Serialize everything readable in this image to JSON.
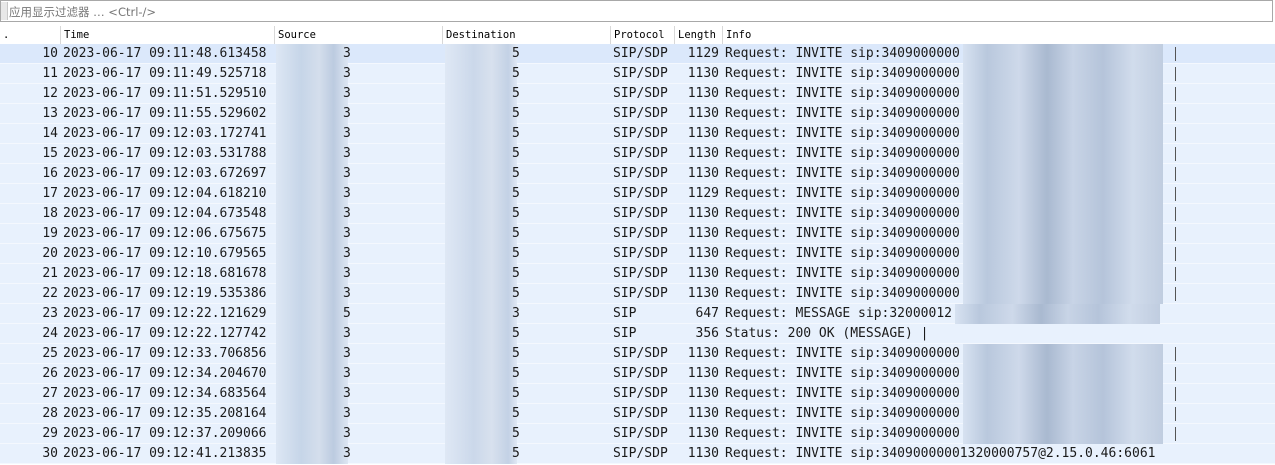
{
  "filter": {
    "placeholder": "应用显示过滤器 … <Ctrl-/>"
  },
  "columns": [
    {
      "label": "."
    },
    {
      "label": "Time"
    },
    {
      "label": "Source"
    },
    {
      "label": "Destination"
    },
    {
      "label": "Protocol"
    },
    {
      "label": "Length"
    },
    {
      "label": "Info"
    }
  ],
  "packets": [
    {
      "no": "10",
      "time": "2023-06-17 09:11:48.613458",
      "src": "3",
      "dst": "5",
      "proto": "SIP/SDP",
      "len": "1129",
      "info": "Request: INVITE sip:3409000000",
      "bar": true
    },
    {
      "no": "11",
      "time": "2023-06-17 09:11:49.525718",
      "src": "3",
      "dst": "5",
      "proto": "SIP/SDP",
      "len": "1130",
      "info": "Request: INVITE sip:3409000000",
      "bar": true
    },
    {
      "no": "12",
      "time": "2023-06-17 09:11:51.529510",
      "src": "3",
      "dst": "5",
      "proto": "SIP/SDP",
      "len": "1130",
      "info": "Request: INVITE sip:3409000000",
      "bar": true
    },
    {
      "no": "13",
      "time": "2023-06-17 09:11:55.529602",
      "src": "3",
      "dst": "5",
      "proto": "SIP/SDP",
      "len": "1130",
      "info": "Request: INVITE sip:3409000000",
      "bar": true
    },
    {
      "no": "14",
      "time": "2023-06-17 09:12:03.172741",
      "src": "3",
      "dst": "5",
      "proto": "SIP/SDP",
      "len": "1130",
      "info": "Request: INVITE sip:3409000000",
      "bar": true
    },
    {
      "no": "15",
      "time": "2023-06-17 09:12:03.531788",
      "src": "3",
      "dst": "5",
      "proto": "SIP/SDP",
      "len": "1130",
      "info": "Request: INVITE sip:3409000000",
      "bar": true
    },
    {
      "no": "16",
      "time": "2023-06-17 09:12:03.672697",
      "src": "3",
      "dst": "5",
      "proto": "SIP/SDP",
      "len": "1130",
      "info": "Request: INVITE sip:3409000000",
      "bar": true
    },
    {
      "no": "17",
      "time": "2023-06-17 09:12:04.618210",
      "src": "3",
      "dst": "5",
      "proto": "SIP/SDP",
      "len": "1129",
      "info": "Request: INVITE sip:3409000000",
      "bar": true
    },
    {
      "no": "18",
      "time": "2023-06-17 09:12:04.673548",
      "src": "3",
      "dst": "5",
      "proto": "SIP/SDP",
      "len": "1130",
      "info": "Request: INVITE sip:3409000000",
      "bar": true
    },
    {
      "no": "19",
      "time": "2023-06-17 09:12:06.675675",
      "src": "3",
      "dst": "5",
      "proto": "SIP/SDP",
      "len": "1130",
      "info": "Request: INVITE sip:3409000000",
      "bar": true
    },
    {
      "no": "20",
      "time": "2023-06-17 09:12:10.679565",
      "src": "3",
      "dst": "5",
      "proto": "SIP/SDP",
      "len": "1130",
      "info": "Request: INVITE sip:3409000000",
      "bar": true
    },
    {
      "no": "21",
      "time": "2023-06-17 09:12:18.681678",
      "src": "3",
      "dst": "5",
      "proto": "SIP/SDP",
      "len": "1130",
      "info": "Request: INVITE sip:3409000000",
      "bar": true
    },
    {
      "no": "22",
      "time": "2023-06-17 09:12:19.535386",
      "src": "3",
      "dst": "5",
      "proto": "SIP/SDP",
      "len": "1130",
      "info": "Request: INVITE sip:3409000000",
      "bar": true
    },
    {
      "no": "23",
      "time": "2023-06-17 09:12:22.121629",
      "src": "5",
      "dst": "3",
      "proto": "SIP",
      "len": "647",
      "info": "Request: MESSAGE sip:32000012",
      "bar": false
    },
    {
      "no": "24",
      "time": "2023-06-17 09:12:22.127742",
      "src": "3",
      "dst": "5",
      "proto": "SIP",
      "len": "356",
      "info": "Status: 200 OK (MESSAGE) |",
      "bar": false
    },
    {
      "no": "25",
      "time": "2023-06-17 09:12:33.706856",
      "src": "3",
      "dst": "5",
      "proto": "SIP/SDP",
      "len": "1130",
      "info": "Request: INVITE sip:3409000000",
      "bar": true
    },
    {
      "no": "26",
      "time": "2023-06-17 09:12:34.204670",
      "src": "3",
      "dst": "5",
      "proto": "SIP/SDP",
      "len": "1130",
      "info": "Request: INVITE sip:3409000000",
      "bar": true
    },
    {
      "no": "27",
      "time": "2023-06-17 09:12:34.683564",
      "src": "3",
      "dst": "5",
      "proto": "SIP/SDP",
      "len": "1130",
      "info": "Request: INVITE sip:3409000000",
      "bar": true
    },
    {
      "no": "28",
      "time": "2023-06-17 09:12:35.208164",
      "src": "3",
      "dst": "5",
      "proto": "SIP/SDP",
      "len": "1130",
      "info": "Request: INVITE sip:3409000000",
      "bar": true
    },
    {
      "no": "29",
      "time": "2023-06-17 09:12:37.209066",
      "src": "3",
      "dst": "5",
      "proto": "SIP/SDP",
      "len": "1130",
      "info": "Request: INVITE sip:3409000000",
      "bar": true
    },
    {
      "no": "30",
      "time": "2023-06-17 09:12:41.213835",
      "src": "3",
      "dst": "5",
      "proto": "SIP/SDP",
      "len": "1130",
      "info": "Request: INVITE sip:34090000001320000757@2.15.0.46:6061",
      "bar": false
    }
  ]
}
